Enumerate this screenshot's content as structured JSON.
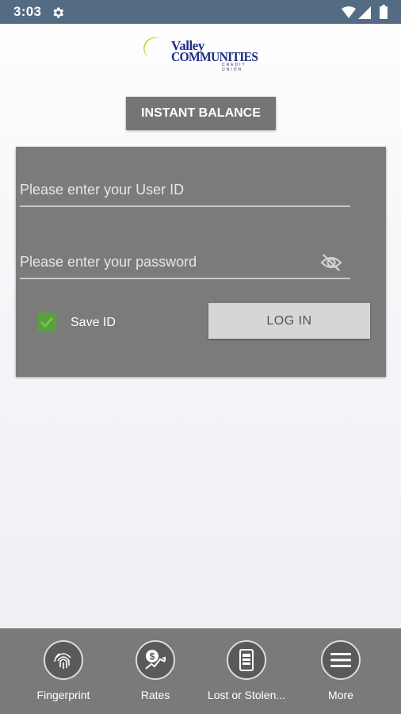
{
  "status_bar": {
    "time": "3:03",
    "icons": [
      "gear-icon",
      "wifi-icon",
      "signal-icon",
      "battery-icon"
    ]
  },
  "logo": {
    "line1": "Valley",
    "line2": "COMMUNITIES",
    "line3": "CREDIT UNION"
  },
  "instant_balance_label": "INSTANT BALANCE",
  "login": {
    "user_id_placeholder": "Please enter your User ID",
    "password_placeholder": "Please enter your password",
    "save_id_label": "Save ID",
    "save_id_checked": true,
    "login_button_label": "LOG IN"
  },
  "bottom_nav": {
    "items": [
      {
        "label": "Fingerprint",
        "icon": "fingerprint-icon"
      },
      {
        "label": "Rates",
        "icon": "rates-icon"
      },
      {
        "label": "Lost or Stolen...",
        "icon": "card-icon"
      },
      {
        "label": "More",
        "icon": "menu-icon"
      }
    ]
  },
  "colors": {
    "status_bar": "#536b83",
    "card": "#7b7b7b",
    "checkbox": "#58a23c",
    "logo_blue": "#1e2f83",
    "logo_yellow": "#c9cf2b"
  }
}
